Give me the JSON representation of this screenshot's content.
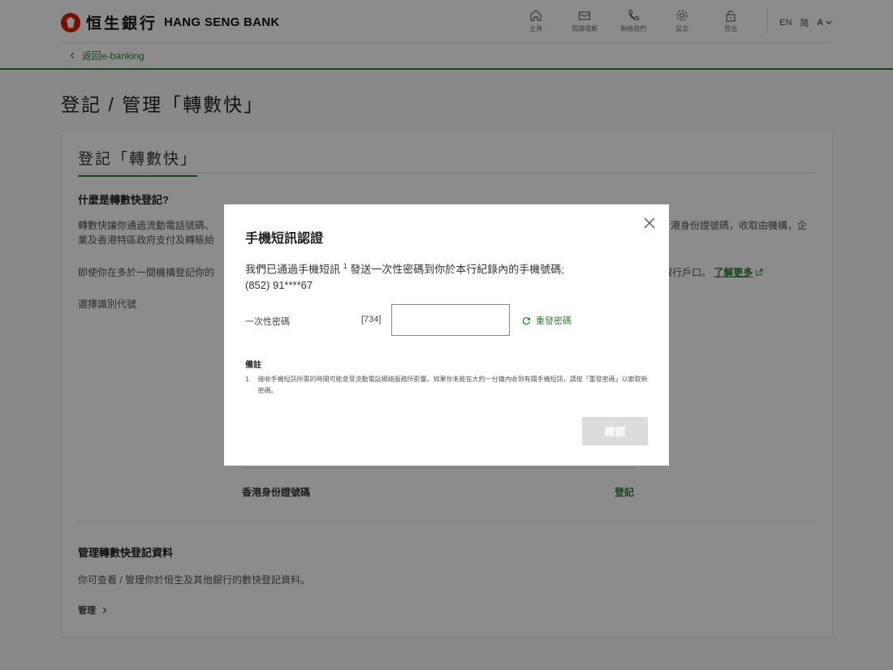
{
  "header": {
    "logo_cn": "恒生銀行",
    "logo_en": "HANG SENG BANK",
    "nav": [
      {
        "label": "主頁",
        "icon": "home-icon"
      },
      {
        "label": "閱讀電郵",
        "icon": "mail-icon"
      },
      {
        "label": "聯絡我們",
        "icon": "phone-icon"
      },
      {
        "label": "設定",
        "icon": "gear-icon"
      },
      {
        "label": "登出",
        "icon": "lock-icon"
      }
    ],
    "lang_en": "EN",
    "lang_sc": "简",
    "font_size": "A",
    "back_label": "返回e-banking"
  },
  "page": {
    "title": "登記 / 管理「轉數快」"
  },
  "card": {
    "title": "登記「轉數快」",
    "question": "什麼是轉數快登記?",
    "para1_a": "轉數快讓你通過流動電話號碼、",
    "para1_b": "業及香港特區政府支付及轉賬給",
    "para1_right": "港身份證號碼，收取由機構，企",
    "para2": "即使你在多於一間機構登記你的",
    "para2_right": "銀行戶口。",
    "learn_more": "了解更多",
    "choose_id": "選擇識別代號",
    "id_label": "香港身份證號碼",
    "id_action": "登記",
    "manage_title": "管理轉數快登記資料",
    "manage_desc": "你可查看 / 管理你於恒生及其他銀行的數快登記資料。",
    "manage_link": "管理"
  },
  "modal": {
    "title": "手機短訊認證",
    "msg_before": "我們已通過手機短訊 ",
    "msg_sup": "1",
    "msg_after": " 發送一次性密碼到你於本行紀錄內的手機號碼;",
    "phone": "(852) 91****67",
    "otp_label": "一次性密碼",
    "otp_prefix": "[734]",
    "otp_value": "",
    "resend": "重發密碼",
    "notes_title": "備註",
    "note_num": "1.",
    "note_text": "接收手機短訊所需的時間可能會受流動電話網絡服務所影響。如果你未能在大約一分鐘內收到有關手機短訊，請按「重發密碼」以索取新密碼。",
    "confirm": "確認"
  },
  "colors": {
    "accent": "#2e7d32",
    "brand_red": "#d81e05",
    "disabled": "#dcdcdc"
  }
}
